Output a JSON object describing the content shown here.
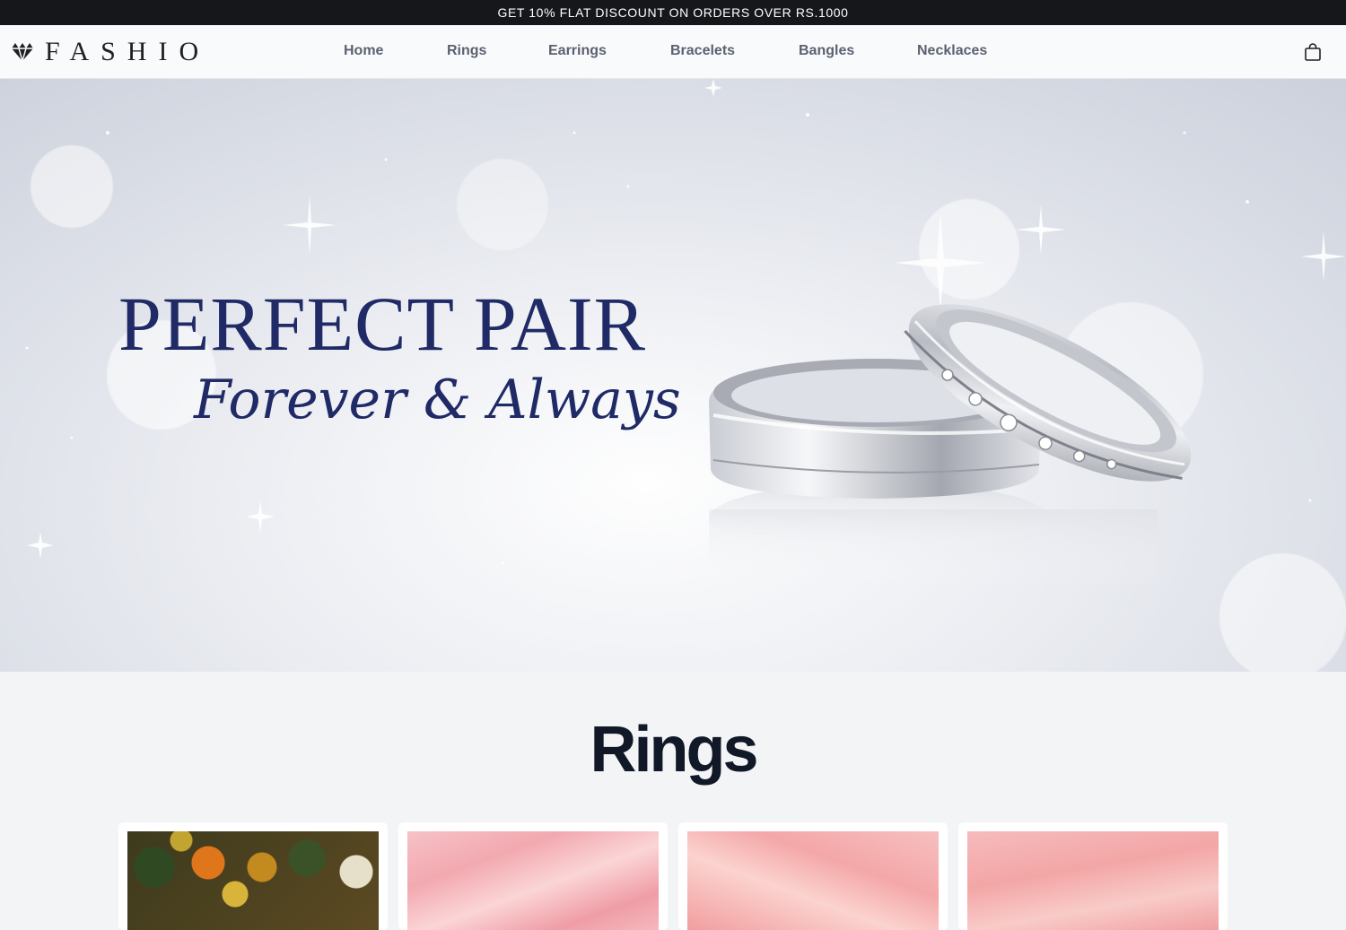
{
  "announcement": "GET 10% FLAT DISCOUNT ON ORDERS OVER RS.1000",
  "brand": {
    "name": "FASHIO",
    "icon": "diamond-icon"
  },
  "nav": {
    "links": [
      "Home",
      "Rings",
      "Earrings",
      "Bracelets",
      "Bangles",
      "Necklaces"
    ],
    "cart_icon": "shopping-bag-icon"
  },
  "hero": {
    "title": "PERFECT PAIR",
    "subtitle": "Forever & Always"
  },
  "section": {
    "title": "Rings",
    "products": [
      {
        "image": "vegetables-photo"
      },
      {
        "image": "pink-silk-photo"
      },
      {
        "image": "pink-silk-photo"
      },
      {
        "image": "pink-silk-photo"
      }
    ]
  },
  "colors": {
    "announcement_bg": "#16171b",
    "hero_text": "#1f2a66",
    "nav_text": "#5b6170",
    "heading": "#111827",
    "page_bg": "#f3f4f6"
  }
}
